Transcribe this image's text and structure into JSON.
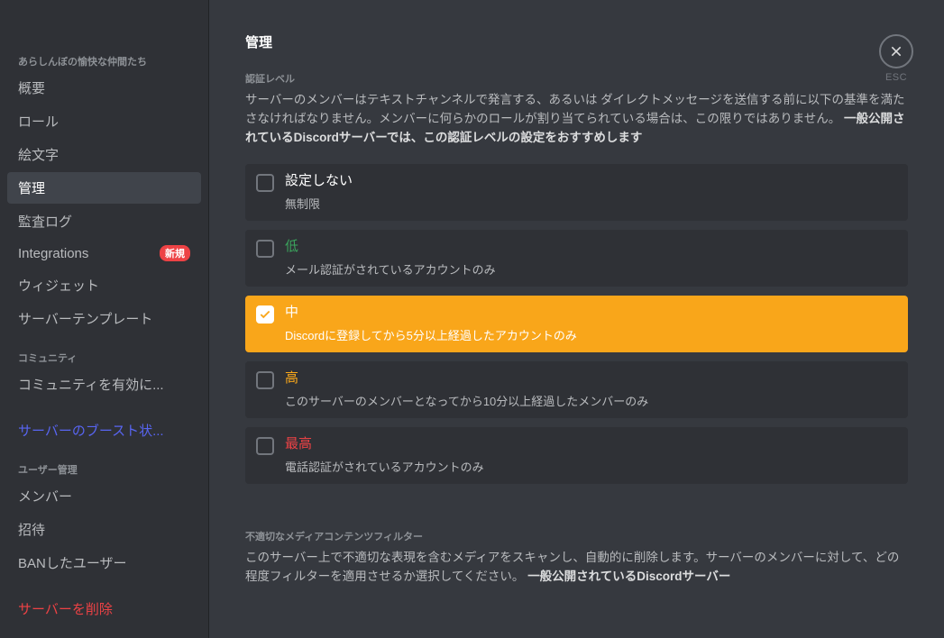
{
  "sidebar": {
    "server_name": "あらしんぼの愉快な仲間たち",
    "items": {
      "overview": "概要",
      "roles": "ロール",
      "emoji": "絵文字",
      "moderation": "管理",
      "audit_log": "監査ログ",
      "integrations": "Integrations",
      "integrations_badge": "新規",
      "widget": "ウィジェット",
      "server_template": "サーバーテンプレート"
    },
    "community_header": "コミュニティ",
    "community_enable": "コミュニティを有効に...",
    "boost": "サーバーのブースト状...",
    "user_mgmt_header": "ユーザー管理",
    "members": "メンバー",
    "invites": "招待",
    "bans": "BANしたユーザー",
    "delete_server": "サーバーを削除"
  },
  "main": {
    "title": "管理",
    "verification": {
      "header": "認証レベル",
      "desc_plain_1": "サーバーのメンバーはテキストチャンネルで発言する、あるいは ダイレクトメッセージを送信する前に以下の基準を満たさなければなりません。メンバーに何らかのロールが割り当てられている場合は、この限りではありません。 ",
      "desc_bold": "一般公開されているDiscordサーバーでは、この認証レベルの設定をおすすめします",
      "options": [
        {
          "label": "設定しない",
          "desc": "無制限",
          "level": "none"
        },
        {
          "label": "低",
          "desc": "メール認証がされているアカウントのみ",
          "level": "low"
        },
        {
          "label": "中",
          "desc": "Discordに登録してから5分以上経過したアカウントのみ",
          "level": "medium"
        },
        {
          "label": "高",
          "desc": "このサーバーのメンバーとなってから10分以上経過したメンバーのみ",
          "level": "high"
        },
        {
          "label": "最高",
          "desc": "電話認証がされているアカウントのみ",
          "level": "highest"
        }
      ]
    },
    "media_filter": {
      "header": "不適切なメディアコンテンツフィルター",
      "desc_plain": "このサーバー上で不適切な表現を含むメディアをスキャンし、自動的に削除します。サーバーのメンバーに対して、どの程度フィルターを適用させるか選択してください。",
      "desc_bold": "一般公開されているDiscordサーバー"
    }
  },
  "close": {
    "label": "ESC"
  }
}
